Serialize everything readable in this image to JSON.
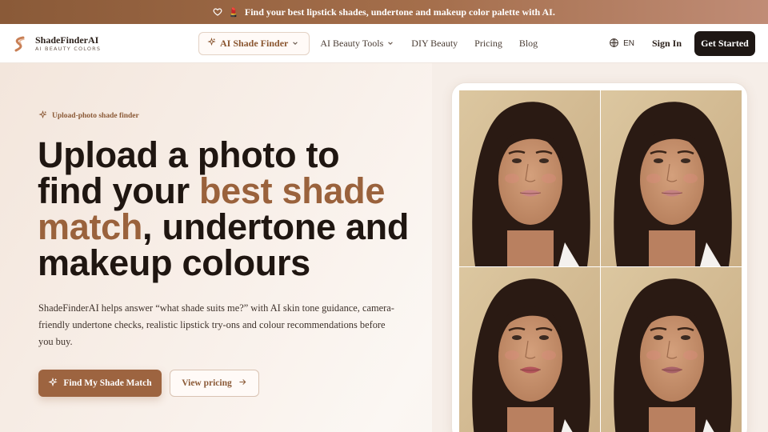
{
  "announcement": {
    "icon": "heart-icon",
    "emoji": "💄",
    "text": "Find your best lipstick shades, undertone and makeup color palette with AI."
  },
  "brand": {
    "name": "ShadeFinderAI",
    "tagline": "AI BEAUTY COLORS"
  },
  "nav": {
    "items": [
      {
        "label": "AI Shade Finder",
        "active": true,
        "dropdown": true
      },
      {
        "label": "AI Beauty Tools",
        "active": false,
        "dropdown": true
      },
      {
        "label": "DIY Beauty",
        "active": false,
        "dropdown": false
      },
      {
        "label": "Pricing",
        "active": false,
        "dropdown": false
      },
      {
        "label": "Blog",
        "active": false,
        "dropdown": false
      }
    ],
    "language": "EN",
    "signin": "Sign In",
    "cta": "Get Started"
  },
  "hero": {
    "eyebrow": "Upload-photo shade finder",
    "headline_part1": "Upload a photo to find your ",
    "headline_accent": "best shade match",
    "headline_part2": ", undertone and makeup colours",
    "description": "ShadeFinderAI helps answer “what shade suits me?” with AI skin tone guidance, camera-friendly undertone checks, realistic lipstick try-ons and colour recommendations before you buy.",
    "primary_button": "Find My Shade Match",
    "secondary_button": "View pricing"
  },
  "colors": {
    "accent": "#9a623c",
    "dark": "#1f1611",
    "lip_shades": [
      "#c98585",
      "#c48282",
      "#b3545a",
      "#a86268"
    ]
  }
}
